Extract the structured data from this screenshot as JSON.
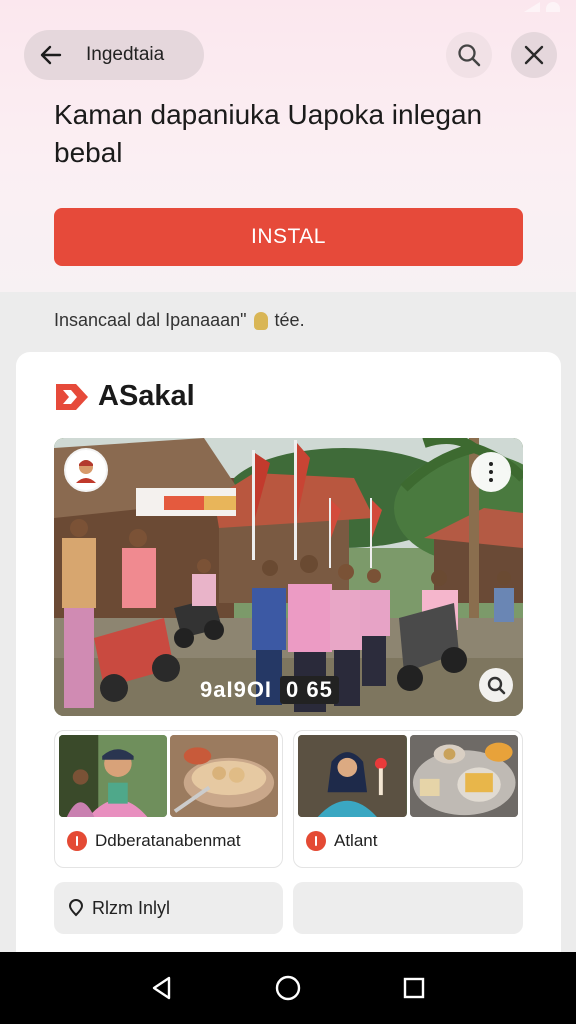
{
  "ad_header": {
    "title": "Ingedtaia",
    "icons": [
      "back-arrow-icon",
      "search-icon",
      "close-icon"
    ]
  },
  "headline": "Kaman dapaniuka Uapoka inlegan bebal",
  "install_label": "INSTAL",
  "info_line": {
    "text_before": "Insancaal dal Ipanaaan\"",
    "text_after": "tée."
  },
  "card": {
    "brand_name": "ASakal",
    "hero": {
      "caption_left": "9aI9OI",
      "caption_tag": "0 65"
    },
    "tiles": [
      {
        "label": "Ddberatanabenmat"
      },
      {
        "label": "Atlant"
      }
    ],
    "chips": [
      {
        "label": "Rlzm Inlyl"
      },
      {
        "label": ""
      }
    ]
  },
  "colors": {
    "install_button": "#e64a3a",
    "brand_red": "#e64a3a",
    "top_background": "#fbe7ee"
  },
  "nav": [
    "back-triangle-icon",
    "home-circle-icon",
    "recents-square-icon"
  ]
}
